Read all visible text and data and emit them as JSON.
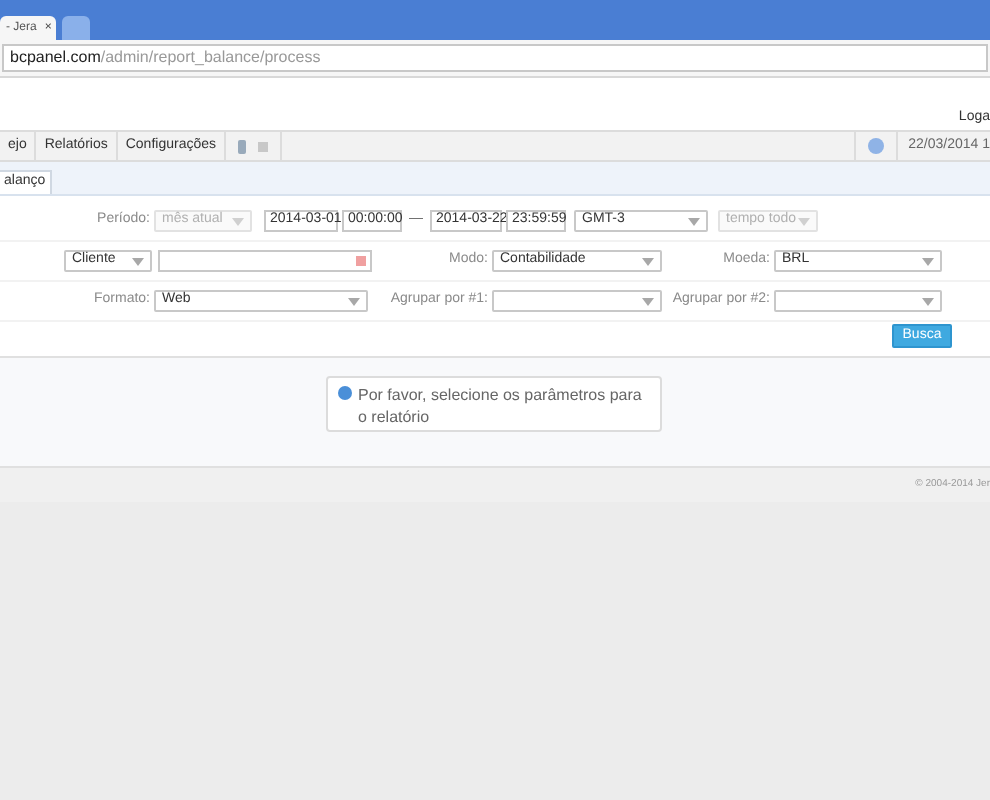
{
  "browser": {
    "tabs": [
      {
        "title": "- Jera",
        "close": "×",
        "selected": true
      },
      {
        "selected": false
      }
    ],
    "address": {
      "domain": "bcpanel.com",
      "path": "/admin/report_balance/process"
    }
  },
  "header": {
    "logout": "Loga"
  },
  "nav": {
    "items": [
      {
        "label": "ejo"
      },
      {
        "label": "Relatórios"
      },
      {
        "label": "Configurações"
      }
    ],
    "datetime": "22/03/2014 1"
  },
  "page_tabs": [
    {
      "label": "alanço",
      "selected": true
    }
  ],
  "form": {
    "rows": [
      {
        "fields": [
          {
            "kind": "label",
            "text": "Período:"
          },
          {
            "kind": "select",
            "value": "mês atual",
            "disabled": true
          },
          {
            "kind": "input",
            "value": "2014-03-01"
          },
          {
            "kind": "input",
            "value": "00:00:00"
          },
          {
            "kind": "dash",
            "text": "—"
          },
          {
            "kind": "input",
            "value": "2014-03-22"
          },
          {
            "kind": "input",
            "value": "23:59:59"
          },
          {
            "kind": "select",
            "value": "GMT-3",
            "disabled": false
          },
          {
            "kind": "select",
            "value": "tempo todo",
            "disabled": true
          }
        ]
      },
      {
        "fields": [
          {
            "kind": "select",
            "value": "Cliente",
            "disabled": false
          },
          {
            "kind": "clearable"
          },
          {
            "kind": "label",
            "text": "Modo:"
          },
          {
            "kind": "select",
            "value": "Contabilidade",
            "disabled": false
          },
          {
            "kind": "label",
            "text": "Moeda:"
          },
          {
            "kind": "select",
            "value": "BRL",
            "disabled": false
          }
        ]
      },
      {
        "fields": [
          {
            "kind": "label",
            "text": "Formato:"
          },
          {
            "kind": "select",
            "value": "Web",
            "disabled": false
          },
          {
            "kind": "label",
            "text": "Agrupar por #1:"
          },
          {
            "kind": "select",
            "disabled": false
          },
          {
            "kind": "label",
            "text": "Agrupar por #2:"
          },
          {
            "kind": "select",
            "disabled": false
          }
        ]
      }
    ],
    "submit": "Busca"
  },
  "message": "Por favor, selecione os parâmetros para o relatório",
  "footer": {
    "copyright": "© 2004-2014 Jer"
  }
}
